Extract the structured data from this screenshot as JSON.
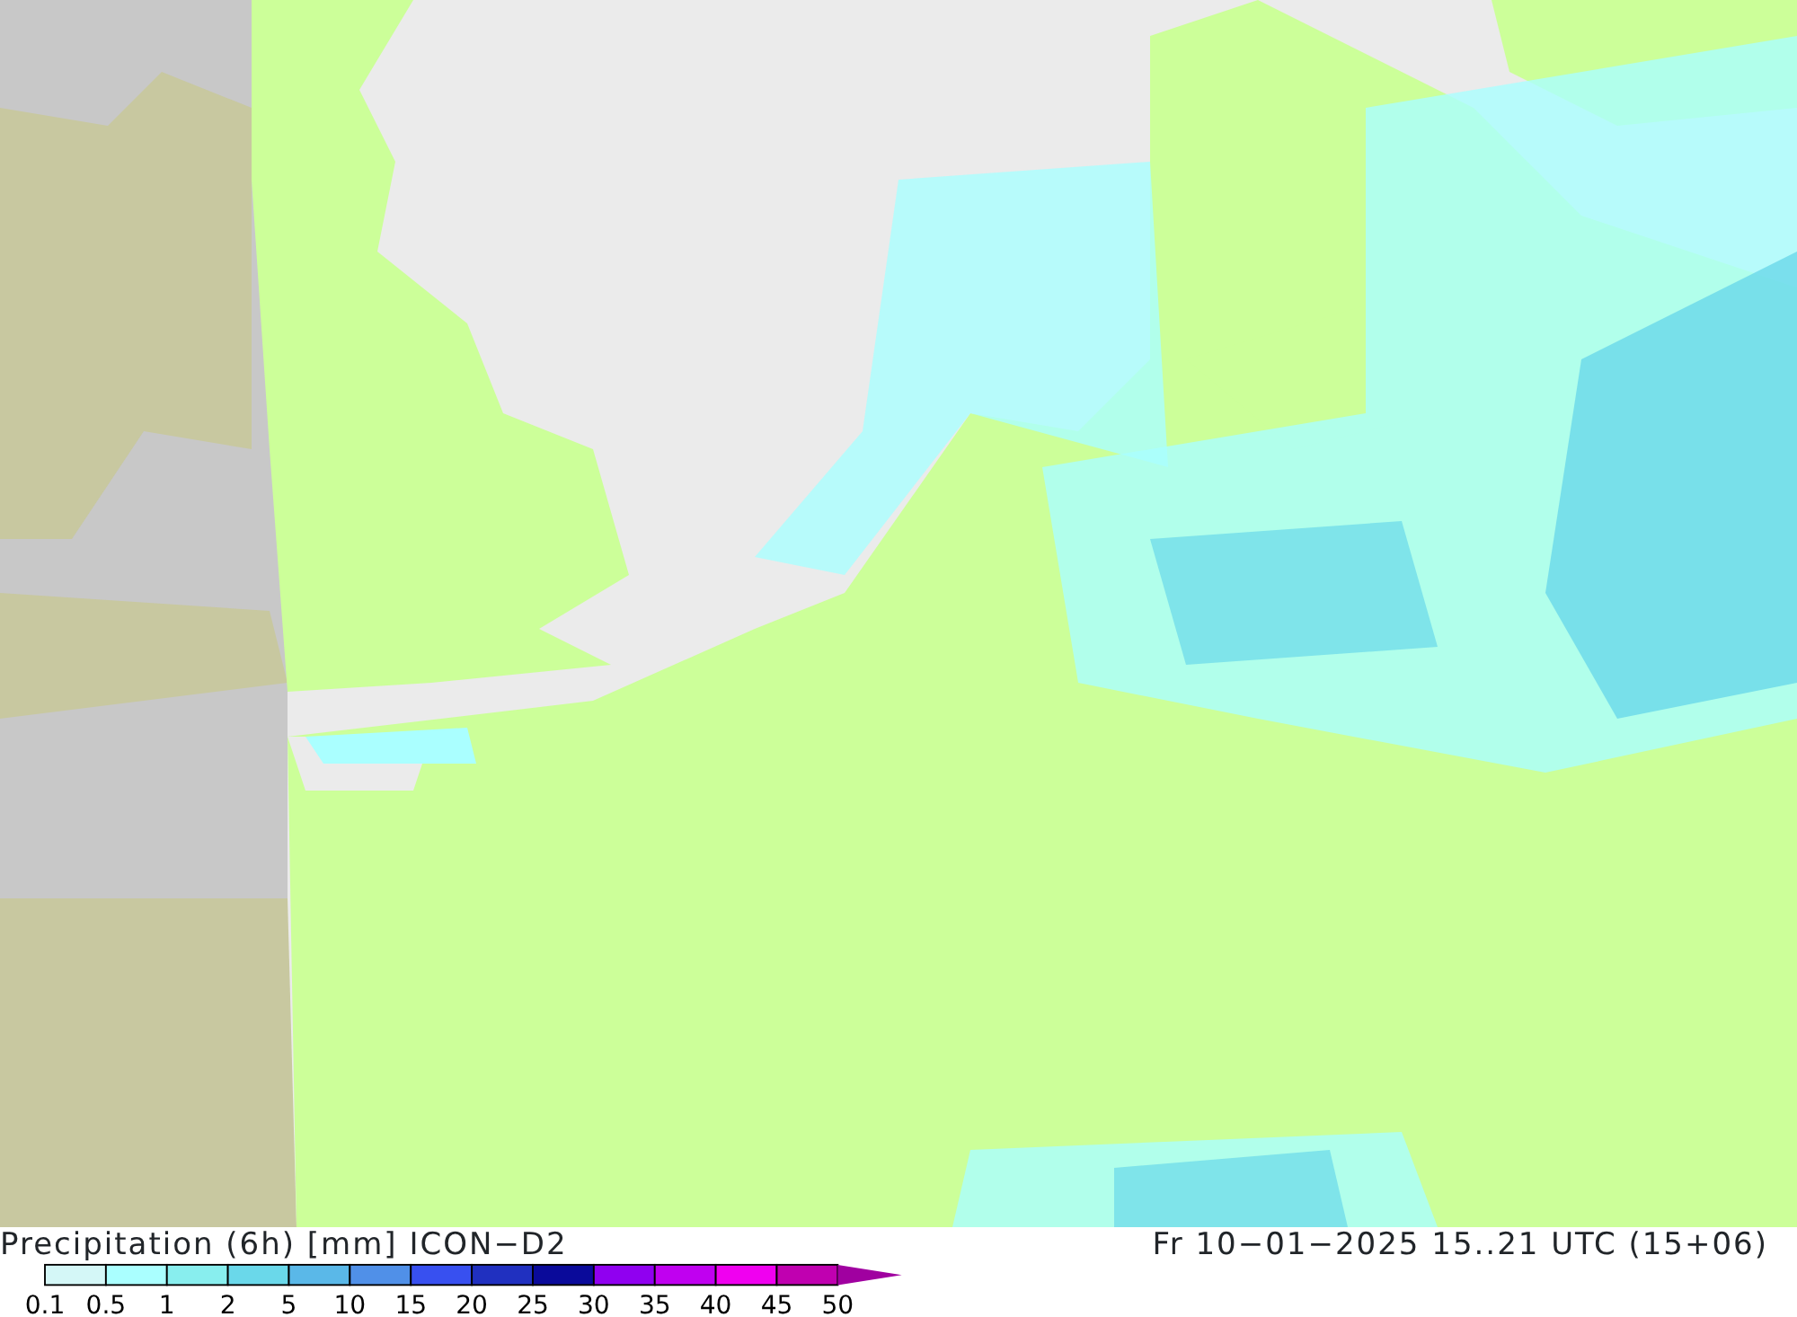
{
  "title": "Precipitation (6h) [mm] ICON−D2",
  "valid_time": "Fr 10−01−2025 15..21 UTC (15+06)",
  "legend": [
    {
      "label": "0.1",
      "color": "#d4f7f7"
    },
    {
      "label": "0.5",
      "color": "#aaffff"
    },
    {
      "label": "1",
      "color": "#88eeee"
    },
    {
      "label": "2",
      "color": "#6ad8ea"
    },
    {
      "label": "5",
      "color": "#5ab8e8"
    },
    {
      "label": "10",
      "color": "#5090e8"
    },
    {
      "label": "15",
      "color": "#3850f0"
    },
    {
      "label": "20",
      "color": "#2030c0"
    },
    {
      "label": "25",
      "color": "#0a0a9a"
    },
    {
      "label": "30",
      "color": "#9000f0"
    },
    {
      "label": "35",
      "color": "#c000f0"
    },
    {
      "label": "40",
      "color": "#f000f0"
    },
    {
      "label": "45",
      "color": "#c000b0"
    },
    {
      "label": "50",
      "color": "#a000a0"
    }
  ]
}
